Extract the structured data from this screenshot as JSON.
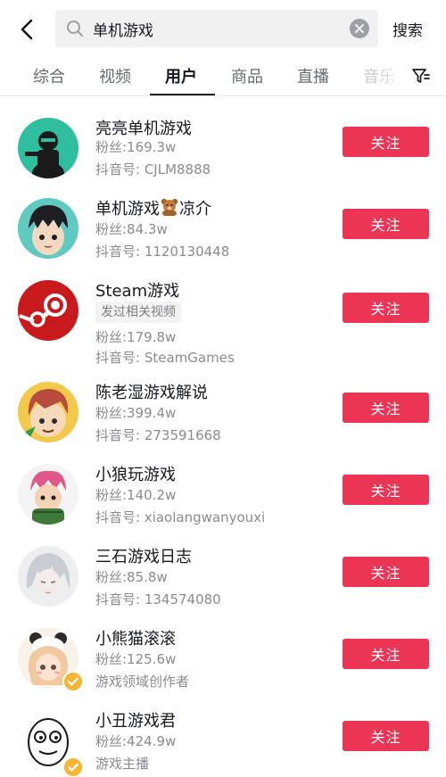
{
  "header": {
    "search_query": "单机游戏",
    "search_button": "搜索"
  },
  "tabs": [
    {
      "label": "综合"
    },
    {
      "label": "视频"
    },
    {
      "label": "用户"
    },
    {
      "label": "商品"
    },
    {
      "label": "直播"
    },
    {
      "label": "音乐"
    }
  ],
  "active_tab": "用户",
  "users": [
    {
      "name": "亮亮单机游戏",
      "line1": "粉丝:169.3w",
      "line2": "抖音号: CJLM8888",
      "follow": "关注"
    },
    {
      "name_pre": "单机游戏",
      "name_post": "凉介",
      "line1": "粉丝:84.3w",
      "line2": "抖音号: 1120130448",
      "follow": "关注"
    },
    {
      "name": "Steam游戏",
      "tag": "发过相关视频",
      "line1": "粉丝:179.8w",
      "line2": "抖音号: SteamGames",
      "follow": "关注"
    },
    {
      "name": "陈老湿游戏解说",
      "line1": "粉丝:399.4w",
      "line2": "抖音号: 273591668",
      "follow": "关注"
    },
    {
      "name": "小狼玩游戏",
      "line1": "粉丝:140.2w",
      "line2": "抖音号: xiaolangwanyouxi",
      "follow": "关注"
    },
    {
      "name": "三石游戏日志",
      "line1": "粉丝:85.8w",
      "line2": "抖音号: 134574080",
      "follow": "关注"
    },
    {
      "name": "小熊猫滚滚",
      "line1": "粉丝:125.6w",
      "line2": "游戏领域创作者",
      "follow": "关注",
      "verified": true
    },
    {
      "name": "小丑游戏君",
      "line1": "粉丝:424.9w",
      "line2": "游戏主播",
      "follow": "关注",
      "verified": true
    }
  ],
  "colors": {
    "follow_button": "#ec3454",
    "verified_badge": "#f5b733",
    "search_box_bg": "#f1f1f2"
  },
  "icons": {
    "back": "chevron-left-icon",
    "search": "search-icon",
    "clear": "clear-icon",
    "filter": "filter-icon",
    "verified": "verified-check-icon",
    "bear_emoji": "teddy-bear-icon"
  }
}
